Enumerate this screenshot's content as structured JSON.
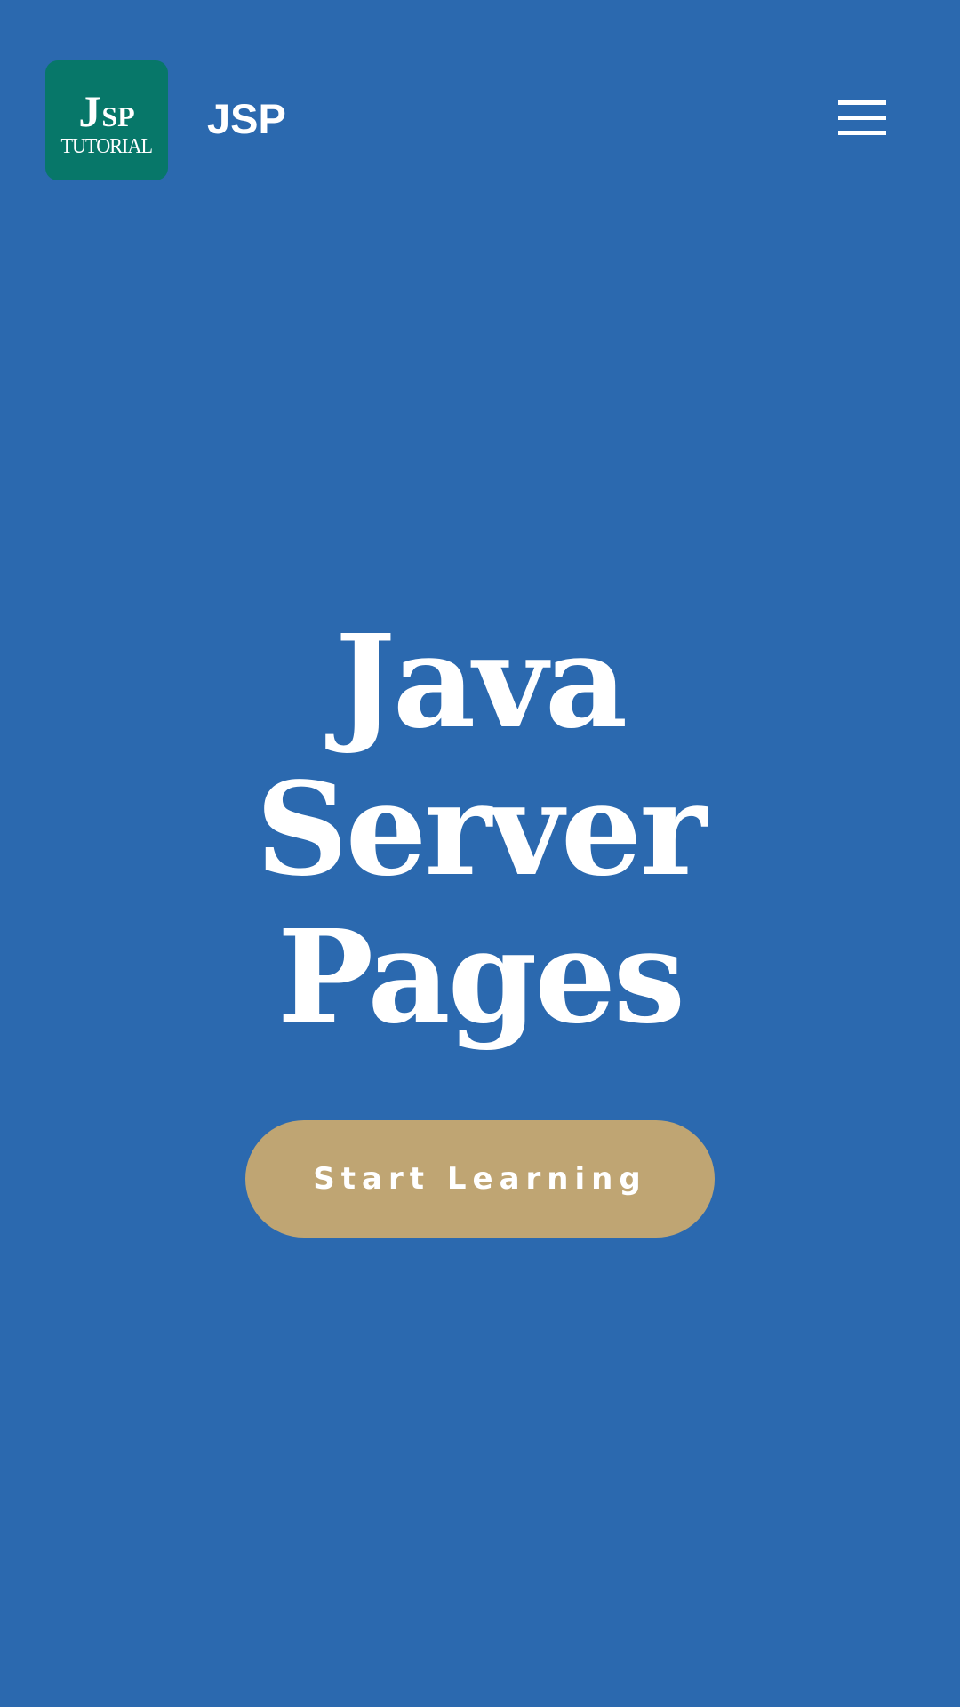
{
  "colors": {
    "background": "#2b69af",
    "logo_tile": "#077769",
    "cta_button": "#bfa573",
    "text": "#ffffff"
  },
  "header": {
    "logo": {
      "line1_big": "J",
      "line1_small": "SP",
      "line2": "TUTORIAL"
    },
    "brand_name": "JSP",
    "menu_icon": "hamburger-menu-icon"
  },
  "hero": {
    "title_lines": [
      "Java",
      "Server",
      "Pages"
    ],
    "cta_label": "Start Learning"
  }
}
